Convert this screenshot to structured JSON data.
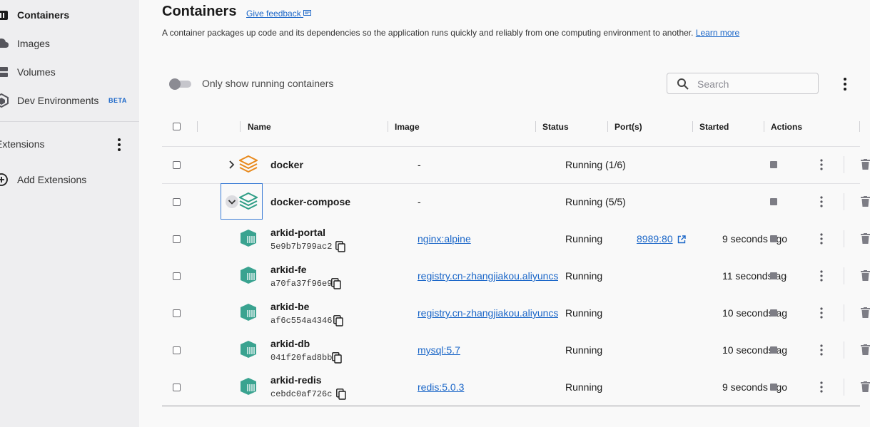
{
  "sidebar": {
    "items": [
      {
        "label": "Containers",
        "icon": "containers-icon",
        "active": true
      },
      {
        "label": "Images",
        "icon": "cloud-icon"
      },
      {
        "label": "Volumes",
        "icon": "volume-icon"
      },
      {
        "label": "Dev Environments",
        "icon": "dev-environments-icon",
        "badge": "BETA"
      }
    ],
    "extensions_title": "Extensions",
    "add_extensions": "Add Extensions"
  },
  "header": {
    "title": "Containers",
    "feedback": "Give feedback",
    "description": "A container packages up code and its dependencies so the application runs quickly and reliably from one computing environment to another.",
    "learn_more": "Learn more"
  },
  "toolbar": {
    "toggle_label": "Only show running containers",
    "search_placeholder": "Search"
  },
  "table": {
    "columns": [
      "Name",
      "Image",
      "Status",
      "Port(s)",
      "Started",
      "Actions"
    ],
    "rows": [
      {
        "name": "docker",
        "id": "",
        "image": "-",
        "status": "Running (1/6)",
        "port": "",
        "started": "",
        "group": true
      },
      {
        "name": "docker-compose",
        "id": "",
        "image": "-",
        "status": "Running (5/5)",
        "port": "",
        "started": "",
        "group": true,
        "expanded": true
      },
      {
        "name": "arkid-portal",
        "id": "5e9b7b799ac2",
        "image": "nginx:alpine",
        "status": "Running",
        "port": "8989:80",
        "started": "9 seconds ago"
      },
      {
        "name": "arkid-fe",
        "id": "a70fa37f96e9",
        "image": "registry.cn-zhangjiakou.aliyuncs.com",
        "status": "Running",
        "port": "",
        "started": "11 seconds ago"
      },
      {
        "name": "arkid-be",
        "id": "af6c554a4346",
        "image": "registry.cn-zhangjiakou.aliyuncs.com",
        "status": "Running",
        "port": "",
        "started": "10 seconds ago"
      },
      {
        "name": "arkid-db",
        "id": "041f20fad8bb",
        "image": "mysql:5.7",
        "status": "Running",
        "port": "",
        "started": "10 seconds ago"
      },
      {
        "name": "arkid-redis",
        "id": "cebdc0af726c",
        "image": "redis:5.0.3",
        "status": "Running",
        "port": "",
        "started": "9 seconds ago"
      }
    ]
  },
  "colors": {
    "accent": "#1a66c8",
    "group_icon": "#e8891c",
    "compose_icon": "#2e9e86",
    "container_icon": "#3aa390"
  }
}
